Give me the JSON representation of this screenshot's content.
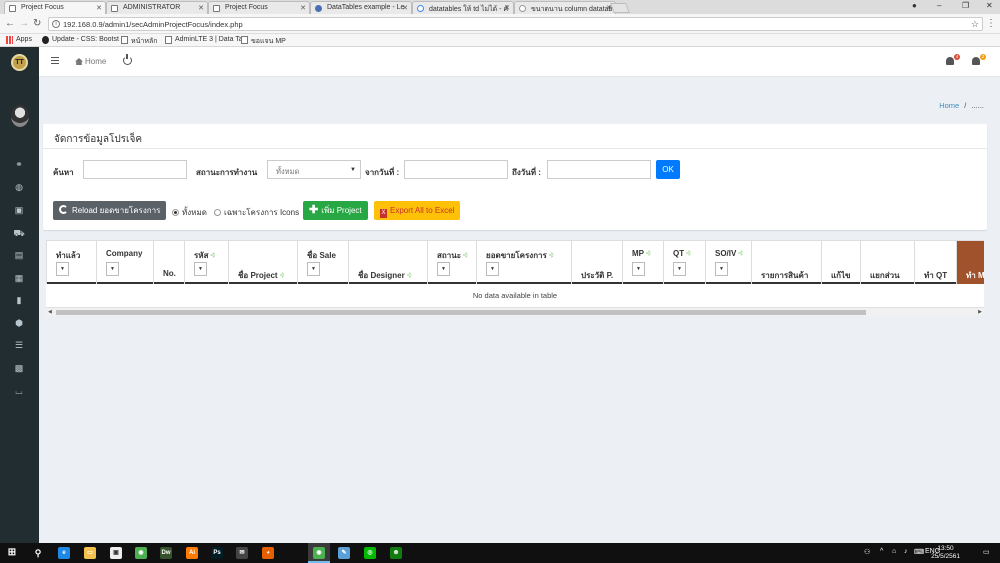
{
  "browser": {
    "tabs": [
      {
        "title": "Project Focus",
        "active": true,
        "icon": "page-icon"
      },
      {
        "title": "ADMINISTRATOR",
        "active": false,
        "icon": "page-icon"
      },
      {
        "title": "Project Focus",
        "active": false,
        "icon": "page-icon"
      },
      {
        "title": "DataTables example - Le",
        "active": false,
        "icon": "datatables-icon"
      },
      {
        "title": "datatables ให้ td ไม่ได้ - ค้",
        "active": false,
        "icon": "google-icon"
      },
      {
        "title": "ขนาดนาน column datatab",
        "active": false,
        "icon": "pantip-icon"
      }
    ],
    "url": "192.168.0.9/admin1/secAdminProjectFocus/index.php",
    "bookmarks": [
      {
        "label": "Apps",
        "icon": "apps-icon"
      },
      {
        "label": "Update - CSS: Bootst",
        "icon": "github-icon"
      },
      {
        "label": "หน้าหลัก",
        "icon": "page-icon"
      },
      {
        "label": "AdminLTE 3 | Data Ta",
        "icon": "page-icon"
      },
      {
        "label": "ขอแจน MP",
        "icon": "page-icon"
      }
    ]
  },
  "app": {
    "brand_text": "TT",
    "nav": {
      "home_label": "Home"
    },
    "notifications": [
      {
        "icon": "megaphone-icon",
        "count": "4",
        "color": "#dd4b39"
      },
      {
        "icon": "bell-icon",
        "count": "2",
        "color": "#f39c12"
      }
    ],
    "sidebar_icons": [
      "handshake-icon",
      "globe-icon",
      "money-icon",
      "truck-icon",
      "file-icon",
      "id-card-icon",
      "bookmark-icon",
      "cube-icon",
      "list-icon",
      "briefcase-icon",
      "basket-icon"
    ],
    "breadcrumb": {
      "home": "Home",
      "sep": "/",
      "current": "......"
    }
  },
  "panel": {
    "title": "จัดการข้อมูลโปรเจ็ค",
    "search_label": "ค้นหา",
    "search_value": "",
    "status_label": "สถานะการทำงาน",
    "status_selected": "ทั้งหมด",
    "from_label": "จากวันที่ :",
    "to_label": "ถึงวันที่ :",
    "ok_label": "OK",
    "reload_label": "Reload ยอดขายโครงการ",
    "radio_all": "ทั้งหมด",
    "radio_icons": "เฉพาะโครงการ Icons",
    "add_label": "เพิ่ม Project",
    "export_label": "Export All to Excel"
  },
  "table": {
    "columns": [
      {
        "label": "ทำแล้ว",
        "filter": true,
        "sort": false,
        "pos": "top"
      },
      {
        "label": "Company",
        "filter": true,
        "sort": false,
        "pos": "top"
      },
      {
        "label": "No.",
        "filter": false,
        "sort": false,
        "pos": "bottom"
      },
      {
        "label": "รหัส",
        "filter": true,
        "sort": true,
        "pos": "top"
      },
      {
        "label": "ชื่อ Project",
        "filter": false,
        "sort": true,
        "pos": "bottom"
      },
      {
        "label": "ชื่อ Sale",
        "filter": true,
        "sort": false,
        "pos": "top"
      },
      {
        "label": "ชื่อ Designer",
        "filter": false,
        "sort": true,
        "pos": "bottom"
      },
      {
        "label": "สถานะ",
        "filter": true,
        "sort": true,
        "pos": "top"
      },
      {
        "label": "ยอดขายโครงการ",
        "filter": true,
        "sort": true,
        "pos": "top"
      },
      {
        "label": "ประวัติ P.",
        "filter": false,
        "sort": false,
        "pos": "bottom"
      },
      {
        "label": "MP",
        "filter": true,
        "sort": true,
        "pos": "top"
      },
      {
        "label": "QT",
        "filter": true,
        "sort": true,
        "pos": "top"
      },
      {
        "label": "SO/IV",
        "filter": true,
        "sort": true,
        "pos": "top"
      },
      {
        "label": "รายการสินค้า",
        "filter": false,
        "sort": false,
        "pos": "bottom"
      },
      {
        "label": "แก้ไข",
        "filter": false,
        "sort": false,
        "pos": "bottom"
      },
      {
        "label": "แยกส่วน",
        "filter": false,
        "sort": false,
        "pos": "bottom"
      },
      {
        "label": "ทำ QT",
        "filter": false,
        "sort": false,
        "pos": "bottom"
      },
      {
        "label": "ทำ MP",
        "filter": false,
        "sort": false,
        "pos": "bottom",
        "highlight": true
      }
    ],
    "empty_text": "No data available in table"
  },
  "taskbar": {
    "apps": [
      "edge-icon",
      "explorer-icon",
      "store-icon",
      "chrome-icon",
      "dreamweaver-icon",
      "illustrator-icon",
      "photoshop-icon",
      "mail-icon",
      "firefox-icon",
      "chrome-icon",
      "notepad-icon",
      "line-icon",
      "xbox-icon"
    ],
    "language": "ENG",
    "time": "13:50",
    "date": "25/5/2561"
  }
}
